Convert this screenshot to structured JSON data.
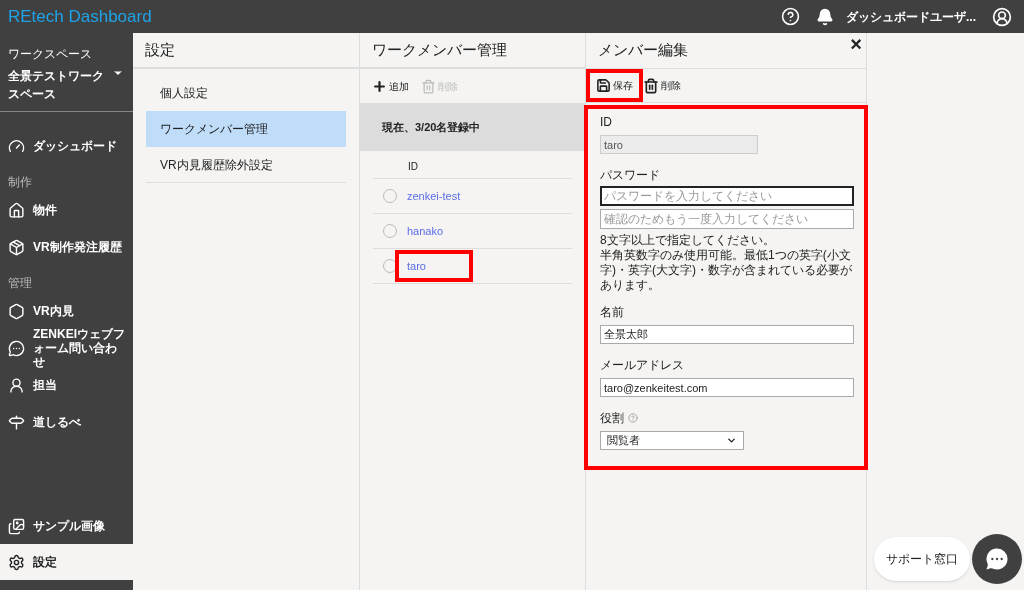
{
  "header": {
    "title": "REtech Dashboard",
    "user": "ダッシュボードユーザ..."
  },
  "sidebar": {
    "workspace_label": "ワークスペース",
    "workspace": "全景テストワークスペース",
    "items": [
      {
        "kind": "item",
        "label": "ダッシュボード",
        "selected": false
      },
      {
        "kind": "section",
        "label": "制作"
      },
      {
        "kind": "item",
        "label": "物件",
        "selected": false
      },
      {
        "kind": "item",
        "label": "VR制作発注履歴",
        "selected": false
      },
      {
        "kind": "section",
        "label": "管理"
      },
      {
        "kind": "item",
        "label": "VR内見",
        "selected": false
      },
      {
        "kind": "item",
        "label": "ZENKEIウェブフォーム問い合わせ",
        "selected": false
      },
      {
        "kind": "item",
        "label": "担当",
        "selected": false
      },
      {
        "kind": "item",
        "label": "道しるべ",
        "selected": false
      }
    ],
    "bottom_items": [
      {
        "label": "サンプル画像",
        "selected": false
      },
      {
        "label": "設定",
        "selected": true
      }
    ]
  },
  "settings": {
    "title": "設定",
    "items": [
      {
        "label": "個人設定",
        "selected": false
      },
      {
        "label": "ワークメンバー管理",
        "selected": true
      },
      {
        "label": "VR内見履歴除外設定",
        "selected": false
      }
    ]
  },
  "members": {
    "title": "ワークメンバー管理",
    "add": "追加",
    "delete": {
      "label": "削除",
      "disabled": true
    },
    "count": "現在、3/20名登録中",
    "column": "ID",
    "rows": [
      {
        "id": "zenkei-test",
        "selected": false,
        "highlighted": false
      },
      {
        "id": "hanako",
        "selected": false,
        "highlighted": false
      },
      {
        "id": "taro",
        "selected": false,
        "highlighted": true
      }
    ]
  },
  "edit": {
    "title": "メンバー編集",
    "close": "×",
    "save": {
      "label": "保存",
      "highlighted": true
    },
    "delete": {
      "label": "削除",
      "disabled": false
    },
    "form_highlighted": true,
    "id_label": "ID",
    "id_value": "taro",
    "password_label": "パスワード",
    "password_placeholder": "パスワードを入力してください",
    "confirm_placeholder": "確認のためもう一度入力してください",
    "hint": [
      "8文字以上で指定してください。",
      "半角英数字のみ使用可能。最低1つの英字(小文字)・英字(大文字)・数字が含まれている必要があります。"
    ],
    "name_label": "名前",
    "name_value": "全景太郎",
    "email_label": "メールアドレス",
    "email_value": "taro@zenkeitest.com",
    "role_label": "役割",
    "role_value": "閲覧者"
  },
  "support": {
    "label": "サポート窓口"
  }
}
